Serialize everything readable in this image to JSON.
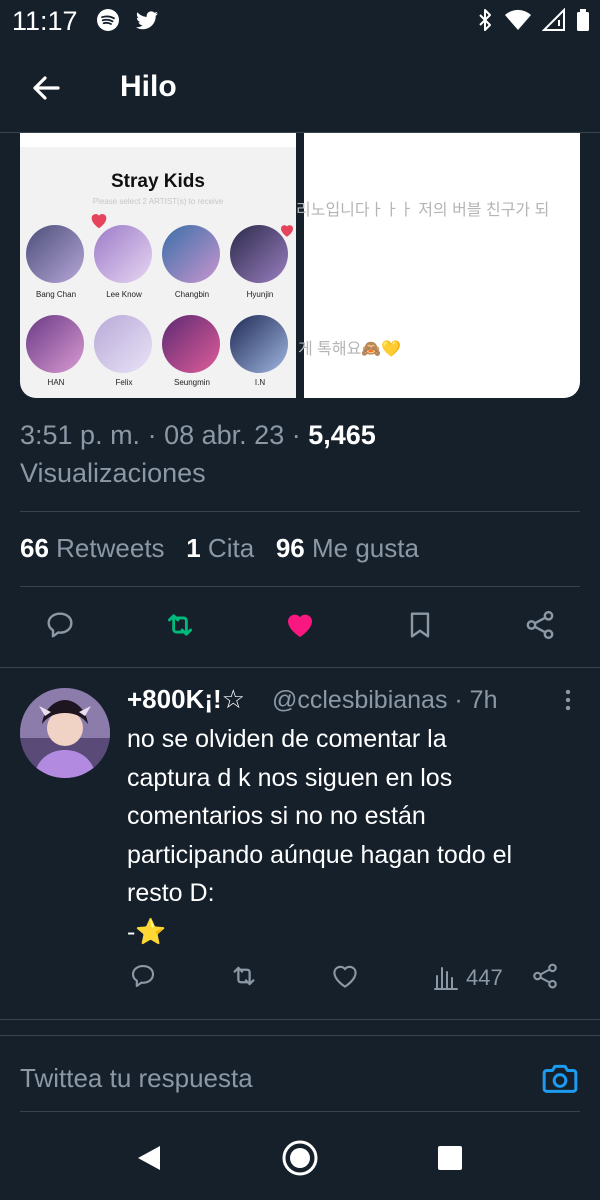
{
  "status_bar": {
    "time": "11:17",
    "left_icons": [
      "spotify-icon",
      "twitter-icon"
    ],
    "right_icons": [
      "bluetooth-icon",
      "wifi-icon",
      "signal-icon",
      "battery-icon"
    ]
  },
  "header": {
    "title": "Hilo"
  },
  "media": {
    "left_image": {
      "title": "Stray Kids",
      "subtitle": "Please select 2 ARTIST(s) to receive",
      "members": [
        "Bang Chan",
        "Lee Know",
        "Changbin",
        "Hyunjin",
        "HAN",
        "Felix",
        "Seungmin",
        "I.N"
      ]
    },
    "right_image": {
      "line1": "리노입니다ㅏㅏㅏ 저의 버블 친구가 되",
      "line2": "게 톡해요🙈💛"
    }
  },
  "tweet_meta": {
    "time": "3:51 p. m.",
    "separator": "·",
    "date": "08 abr. 23",
    "views_count": "5,465",
    "views_label": "Visualizaciones"
  },
  "stats": {
    "retweets_count": "66",
    "retweets_label": "Retweets",
    "quotes_count": "1",
    "quotes_label": "Cita",
    "likes_count": "96",
    "likes_label": "Me gusta"
  },
  "reply": {
    "display_name": "+800K¡!☆",
    "handle": "@cclesbibianas · 7h",
    "text": "no se olviden de comentar la\ncaptura d k nos siguen en los\ncomentarios si no no están\nparticipando aúnque hagan todo el\nresto D:\n-⭐",
    "views": "447"
  },
  "compose": {
    "placeholder": "Twittea tu respuesta"
  },
  "colors": {
    "background": "#15202b",
    "divider": "#38444d",
    "muted_text": "#8b98a5",
    "like_pink": "#f91880",
    "retweet_green": "#00ba7c",
    "accent_blue": "#1d9bf0"
  }
}
